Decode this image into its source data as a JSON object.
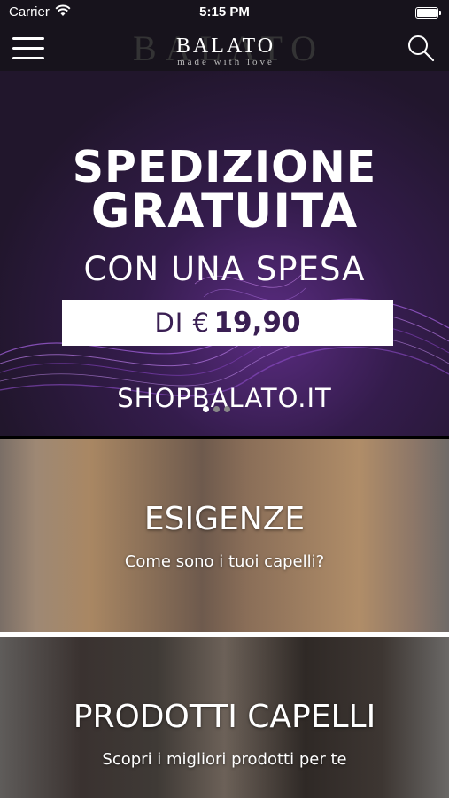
{
  "status_bar": {
    "carrier": "Carrier",
    "time": "5:15 PM"
  },
  "nav": {
    "logo_main": "BALATO",
    "logo_sub": "made with love",
    "menu_icon": "hamburger-menu-icon",
    "search_icon": "search-icon"
  },
  "banner": {
    "line1": "SPEDIZIONE",
    "line2": "GRATUITA",
    "line3": "CON UNA SPESA",
    "price_prefix": "DI €",
    "price_amount": "19,90",
    "website": "SHOPBALATO.IT",
    "pages": 3,
    "active_page": 1
  },
  "cards": [
    {
      "title": "ESIGENZE",
      "subtitle": "Come sono i tuoi capelli?"
    },
    {
      "title": "PRODOTTI CAPELLI",
      "subtitle": "Scopri i migliori prodotti per te"
    }
  ],
  "colors": {
    "nav_bg": "#17131c",
    "banner_purple": "#3a1f53",
    "text": "#ffffff"
  }
}
